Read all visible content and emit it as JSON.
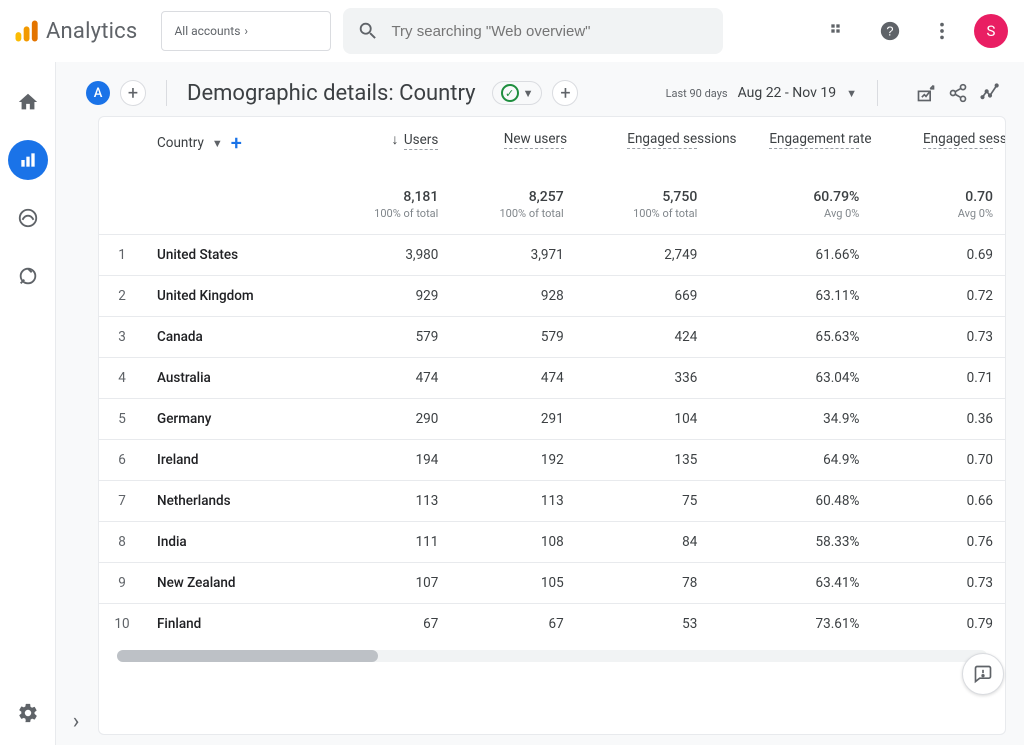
{
  "app": {
    "name": "Analytics",
    "account_crumb": "All accounts",
    "search_placeholder": "Try searching \"Web overview\"",
    "avatar_initial": "S"
  },
  "report": {
    "badge": "A",
    "title": "Demographic details: Country",
    "date_label": "Last 90 days",
    "date_range": "Aug 22 - Nov 19"
  },
  "table": {
    "dimension_label": "Country",
    "columns": [
      {
        "key": "users",
        "label": "Users",
        "sorted": true
      },
      {
        "key": "new_users",
        "label": "New users"
      },
      {
        "key": "engaged_sessions",
        "label": "Engaged sessions"
      },
      {
        "key": "engagement_rate",
        "label": "Engagement rate"
      },
      {
        "key": "eng_per_user",
        "label": "Engaged sessions per user"
      }
    ],
    "summary": {
      "users": {
        "value": "8,181",
        "sub": "100% of total"
      },
      "new_users": {
        "value": "8,257",
        "sub": "100% of total"
      },
      "engaged_sessions": {
        "value": "5,750",
        "sub": "100% of total"
      },
      "engagement_rate": {
        "value": "60.79%",
        "sub": "Avg 0%"
      },
      "eng_per_user": {
        "value": "0.70",
        "sub": "Avg 0%"
      }
    },
    "rows": [
      {
        "idx": "1",
        "dim": "United States",
        "users": "3,980",
        "new_users": "3,971",
        "engaged_sessions": "2,749",
        "engagement_rate": "61.66%",
        "eng_per_user": "0.69"
      },
      {
        "idx": "2",
        "dim": "United Kingdom",
        "users": "929",
        "new_users": "928",
        "engaged_sessions": "669",
        "engagement_rate": "63.11%",
        "eng_per_user": "0.72"
      },
      {
        "idx": "3",
        "dim": "Canada",
        "users": "579",
        "new_users": "579",
        "engaged_sessions": "424",
        "engagement_rate": "65.63%",
        "eng_per_user": "0.73"
      },
      {
        "idx": "4",
        "dim": "Australia",
        "users": "474",
        "new_users": "474",
        "engaged_sessions": "336",
        "engagement_rate": "63.04%",
        "eng_per_user": "0.71"
      },
      {
        "idx": "5",
        "dim": "Germany",
        "users": "290",
        "new_users": "291",
        "engaged_sessions": "104",
        "engagement_rate": "34.9%",
        "eng_per_user": "0.36"
      },
      {
        "idx": "6",
        "dim": "Ireland",
        "users": "194",
        "new_users": "192",
        "engaged_sessions": "135",
        "engagement_rate": "64.9%",
        "eng_per_user": "0.70"
      },
      {
        "idx": "7",
        "dim": "Netherlands",
        "users": "113",
        "new_users": "113",
        "engaged_sessions": "75",
        "engagement_rate": "60.48%",
        "eng_per_user": "0.66"
      },
      {
        "idx": "8",
        "dim": "India",
        "users": "111",
        "new_users": "108",
        "engaged_sessions": "84",
        "engagement_rate": "58.33%",
        "eng_per_user": "0.76"
      },
      {
        "idx": "9",
        "dim": "New Zealand",
        "users": "107",
        "new_users": "105",
        "engaged_sessions": "78",
        "engagement_rate": "63.41%",
        "eng_per_user": "0.73"
      },
      {
        "idx": "10",
        "dim": "Finland",
        "users": "67",
        "new_users": "67",
        "engaged_sessions": "53",
        "engagement_rate": "73.61%",
        "eng_per_user": "0.79"
      }
    ]
  }
}
